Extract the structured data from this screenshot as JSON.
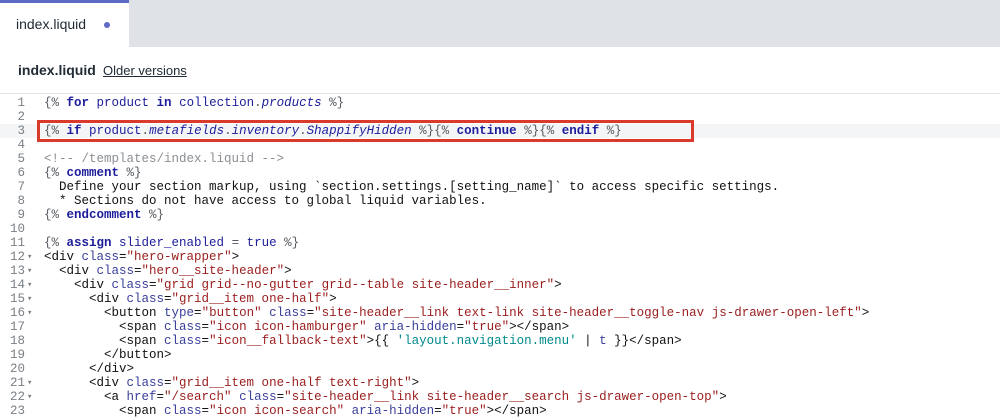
{
  "tab": {
    "label": "index.liquid"
  },
  "file_header": {
    "filename": "index.liquid",
    "older_versions": "Older versions"
  },
  "editor": {
    "lines": [
      {
        "n": "1",
        "fold": "",
        "segs": [
          [
            "dl",
            "{% "
          ],
          [
            "kw",
            "for"
          ],
          [
            "id",
            " product "
          ],
          [
            "kw",
            "in"
          ],
          [
            "id",
            " collection"
          ],
          [
            "dl",
            "."
          ],
          [
            "it",
            "products"
          ],
          [
            "dl",
            " %}"
          ]
        ]
      },
      {
        "n": "2",
        "fold": "",
        "segs": []
      },
      {
        "n": "3",
        "fold": "",
        "active": true,
        "segs": [
          [
            "dl",
            "{% "
          ],
          [
            "kw",
            "if"
          ],
          [
            "id",
            " product"
          ],
          [
            "dl",
            "."
          ],
          [
            "it",
            "metafields"
          ],
          [
            "dl",
            "."
          ],
          [
            "it",
            "inventory"
          ],
          [
            "dl",
            "."
          ],
          [
            "it",
            "ShappifyHidden"
          ],
          [
            "dl",
            " %}{% "
          ],
          [
            "kw",
            "continue"
          ],
          [
            "dl",
            " %}{% "
          ],
          [
            "kw",
            "endif"
          ],
          [
            "dl",
            " %}"
          ]
        ]
      },
      {
        "n": "4",
        "fold": "",
        "segs": []
      },
      {
        "n": "5",
        "fold": "",
        "segs": [
          [
            "cm",
            "<!-- /templates/index.liquid -->"
          ]
        ]
      },
      {
        "n": "6",
        "fold": "",
        "segs": [
          [
            "dl",
            "{% "
          ],
          [
            "kw",
            "comment"
          ],
          [
            "dl",
            " %}"
          ]
        ]
      },
      {
        "n": "7",
        "fold": "",
        "segs": [
          [
            "tg",
            "  Define your section markup, using `section.settings.[setting_name]` to access specific settings."
          ]
        ]
      },
      {
        "n": "8",
        "fold": "",
        "segs": [
          [
            "tg",
            "  * Sections do not have access to global liquid variables."
          ]
        ]
      },
      {
        "n": "9",
        "fold": "",
        "segs": [
          [
            "dl",
            "{% "
          ],
          [
            "kw",
            "endcomment"
          ],
          [
            "dl",
            " %}"
          ]
        ]
      },
      {
        "n": "10",
        "fold": "",
        "segs": []
      },
      {
        "n": "11",
        "fold": "",
        "segs": [
          [
            "dl",
            "{% "
          ],
          [
            "kw",
            "assign"
          ],
          [
            "id",
            " slider_enabled "
          ],
          [
            "dl",
            "= "
          ],
          [
            "id",
            "true"
          ],
          [
            "dl",
            " %}"
          ]
        ]
      },
      {
        "n": "12",
        "fold": "▾",
        "segs": [
          [
            "tg",
            "<div "
          ],
          [
            "at",
            "class"
          ],
          [
            "tg",
            "="
          ],
          [
            "st",
            "\"hero-wrapper\""
          ],
          [
            "tg",
            ">"
          ]
        ]
      },
      {
        "n": "13",
        "fold": "▾",
        "segs": [
          [
            "tg",
            "  <div "
          ],
          [
            "at",
            "class"
          ],
          [
            "tg",
            "="
          ],
          [
            "st",
            "\"hero__site-header\""
          ],
          [
            "tg",
            ">"
          ]
        ]
      },
      {
        "n": "14",
        "fold": "▾",
        "segs": [
          [
            "tg",
            "    <div "
          ],
          [
            "at",
            "class"
          ],
          [
            "tg",
            "="
          ],
          [
            "st",
            "\"grid grid--no-gutter grid--table site-header__inner\""
          ],
          [
            "tg",
            ">"
          ]
        ]
      },
      {
        "n": "15",
        "fold": "▾",
        "segs": [
          [
            "tg",
            "      <div "
          ],
          [
            "at",
            "class"
          ],
          [
            "tg",
            "="
          ],
          [
            "st",
            "\"grid__item one-half\""
          ],
          [
            "tg",
            ">"
          ]
        ]
      },
      {
        "n": "16",
        "fold": "▾",
        "segs": [
          [
            "tg",
            "        <button "
          ],
          [
            "at",
            "type"
          ],
          [
            "tg",
            "="
          ],
          [
            "st",
            "\"button\""
          ],
          [
            "tg",
            " "
          ],
          [
            "at",
            "class"
          ],
          [
            "tg",
            "="
          ],
          [
            "st",
            "\"site-header__link text-link site-header__toggle-nav js-drawer-open-left\""
          ],
          [
            "tg",
            ">"
          ]
        ]
      },
      {
        "n": "17",
        "fold": "",
        "segs": [
          [
            "tg",
            "          <span "
          ],
          [
            "at",
            "class"
          ],
          [
            "tg",
            "="
          ],
          [
            "st",
            "\"icon icon-hamburger\""
          ],
          [
            "tg",
            " "
          ],
          [
            "at",
            "aria-hidden"
          ],
          [
            "tg",
            "="
          ],
          [
            "st",
            "\"true\""
          ],
          [
            "tg",
            "></span>"
          ]
        ]
      },
      {
        "n": "18",
        "fold": "",
        "segs": [
          [
            "tg",
            "          <span "
          ],
          [
            "at",
            "class"
          ],
          [
            "tg",
            "="
          ],
          [
            "st",
            "\"icon__fallback-text\""
          ],
          [
            "tg",
            ">{{ "
          ],
          [
            "lq",
            "'layout.navigation.menu'"
          ],
          [
            "tg",
            " | "
          ],
          [
            "fl",
            "t"
          ],
          [
            "tg",
            " }}</span>"
          ]
        ]
      },
      {
        "n": "19",
        "fold": "",
        "segs": [
          [
            "tg",
            "        </button>"
          ]
        ]
      },
      {
        "n": "20",
        "fold": "",
        "segs": [
          [
            "tg",
            "      </div>"
          ]
        ]
      },
      {
        "n": "21",
        "fold": "▾",
        "segs": [
          [
            "tg",
            "      <div "
          ],
          [
            "at",
            "class"
          ],
          [
            "tg",
            "="
          ],
          [
            "st",
            "\"grid__item one-half text-right\""
          ],
          [
            "tg",
            ">"
          ]
        ]
      },
      {
        "n": "22",
        "fold": "▾",
        "segs": [
          [
            "tg",
            "        <a "
          ],
          [
            "at",
            "href"
          ],
          [
            "tg",
            "="
          ],
          [
            "st",
            "\"/search\""
          ],
          [
            "tg",
            " "
          ],
          [
            "at",
            "class"
          ],
          [
            "tg",
            "="
          ],
          [
            "st",
            "\"site-header__link site-header__search js-drawer-open-top\""
          ],
          [
            "tg",
            ">"
          ]
        ]
      },
      {
        "n": "23",
        "fold": "",
        "segs": [
          [
            "tg",
            "          <span "
          ],
          [
            "at",
            "class"
          ],
          [
            "tg",
            "="
          ],
          [
            "st",
            "\"icon icon-search\""
          ],
          [
            "tg",
            " "
          ],
          [
            "at",
            "aria-hidden"
          ],
          [
            "tg",
            "="
          ],
          [
            "st",
            "\"true\""
          ],
          [
            "tg",
            "></span>"
          ]
        ]
      }
    ]
  }
}
